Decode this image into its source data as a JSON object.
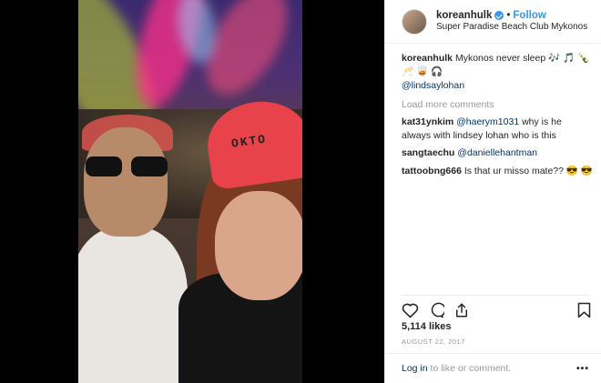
{
  "header": {
    "username": "koreanhulk",
    "separator": "•",
    "follow_label": "Follow",
    "location": "Super Paradise Beach Club Mykonos"
  },
  "photo": {
    "cap_text": "OKTO"
  },
  "caption": {
    "username": "koreanhulk",
    "text": "Mykonos never sleep 🎶 🎵 🍾 🥂 🥃 🎧",
    "mention": "@lindsaylohan"
  },
  "load_more_label": "Load more comments",
  "comments": [
    {
      "user": "kat31ynkim",
      "mention": "@haerym1031",
      "text": " why is he always with lindsey lohan who is this"
    },
    {
      "user": "sangtaechu",
      "mention": "@daniellehantman",
      "text": ""
    },
    {
      "user": "tattoobng666",
      "mention": "",
      "text": "Is that ur misso mate?? 😎 😎"
    }
  ],
  "likes": "5,114 likes",
  "date": "AUGUST 22, 2017",
  "footer": {
    "login_label": "Log in",
    "login_suffix": " to like or comment.",
    "more_label": "•••"
  },
  "colors": {
    "accent": "#3897f0",
    "link": "#003569",
    "muted": "#999999"
  },
  "icons": [
    "verified-badge-icon",
    "heart-icon",
    "comment-icon",
    "share-icon",
    "bookmark-icon",
    "more-options-icon"
  ]
}
